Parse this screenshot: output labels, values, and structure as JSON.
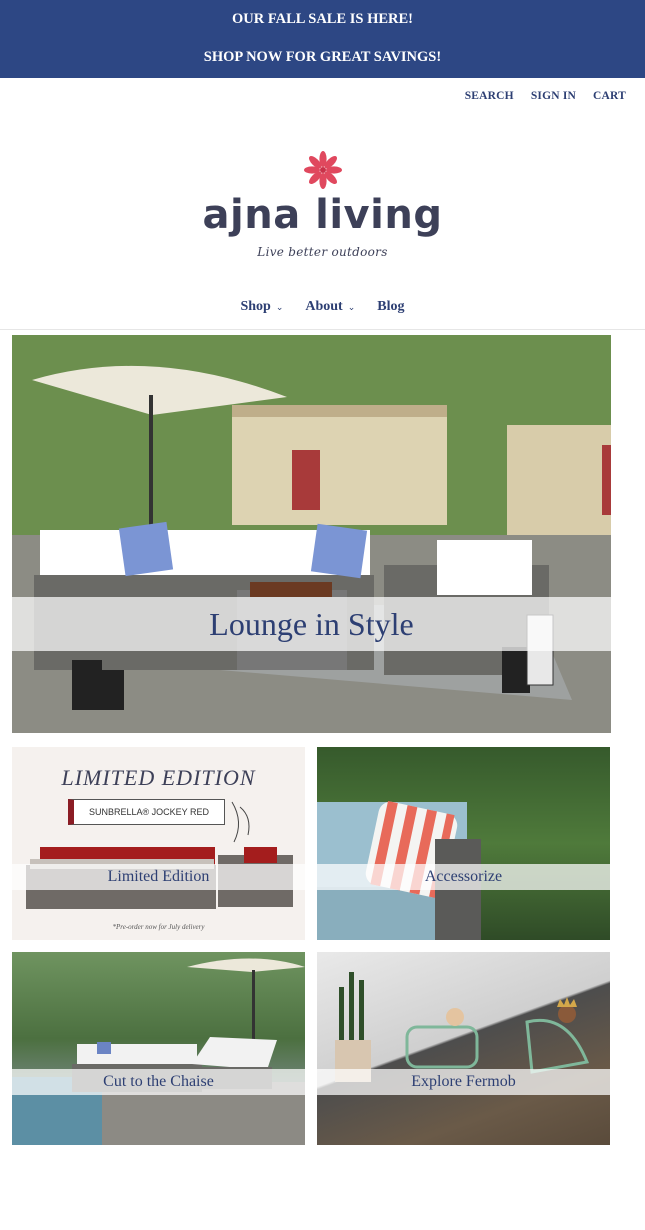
{
  "announcement": {
    "line1": "OUR FALL SALE IS HERE!",
    "line2": "SHOP NOW FOR GREAT SAVINGS!"
  },
  "utility_nav": {
    "search": "SEARCH",
    "sign_in": "SIGN IN",
    "cart": "CART"
  },
  "brand": {
    "name": "ajna living",
    "tagline": "Live better outdoors",
    "accent_color": "#e0485e"
  },
  "main_nav": {
    "shop": "Shop",
    "about": "About",
    "blog": "Blog"
  },
  "hero": {
    "caption": "Lounge in Style"
  },
  "tiles": {
    "limited_edition": {
      "heading": "LIMITED EDITION",
      "badge": "SUNBRELLA® JOCKEY RED",
      "footnote": "*Pre-order now for July delivery",
      "caption": "Limited Edition"
    },
    "accessorize": {
      "caption": "Accessorize"
    },
    "chaise": {
      "caption": "Cut to the Chaise"
    },
    "fermob": {
      "caption": "Explore Fermob"
    }
  },
  "colors": {
    "banner": "#2d4784",
    "nav_text": "#2d3f73"
  }
}
